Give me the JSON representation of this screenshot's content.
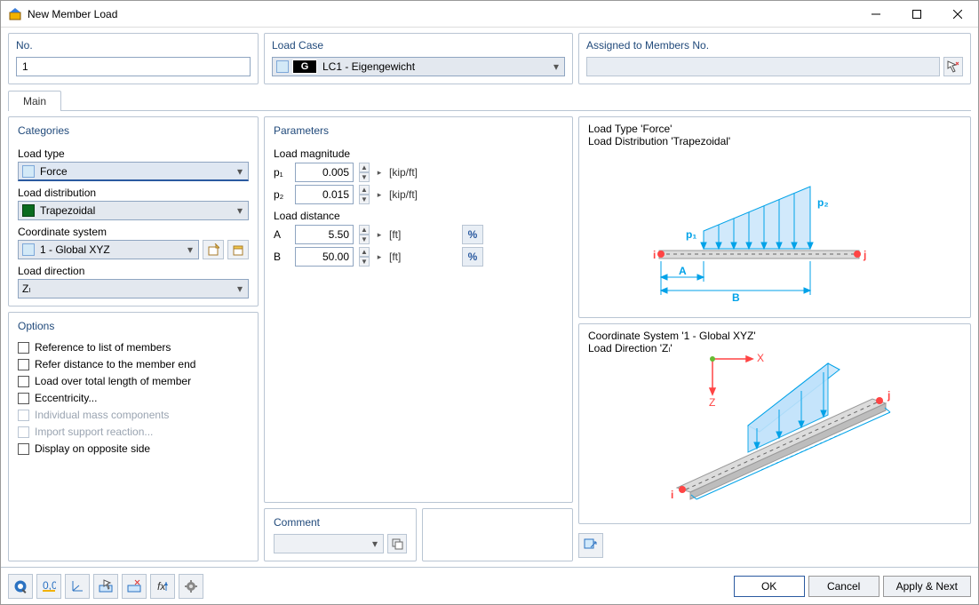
{
  "window": {
    "title": "New Member Load"
  },
  "header": {
    "no": {
      "legend": "No.",
      "value": "1"
    },
    "loadcase": {
      "legend": "Load Case",
      "badge": "G",
      "text": "LC1 - Eigengewicht"
    },
    "assigned": {
      "legend": "Assigned to Members No.",
      "value": ""
    }
  },
  "tabs": {
    "main": "Main"
  },
  "categories": {
    "title": "Categories",
    "load_type_label": "Load type",
    "load_type_value": "Force",
    "load_dist_label": "Load distribution",
    "load_dist_value": "Trapezoidal",
    "coord_sys_label": "Coordinate system",
    "coord_sys_value": "1 - Global XYZ",
    "load_dir_label": "Load direction",
    "load_dir_value": "Zₗ"
  },
  "options": {
    "title": "Options",
    "o1": "Reference to list of members",
    "o2": "Refer distance to the member end",
    "o3": "Load over total length of member",
    "o4": "Eccentricity...",
    "o5": "Individual mass components",
    "o6": "Import support reaction...",
    "o7": "Display on opposite side"
  },
  "parameters": {
    "title": "Parameters",
    "magnitude_label": "Load magnitude",
    "p1_label": "p₁",
    "p1_value": "0.005",
    "p1_unit": "[kip/ft]",
    "p2_label": "p₂",
    "p2_value": "0.015",
    "p2_unit": "[kip/ft]",
    "distance_label": "Load distance",
    "A_label": "A",
    "A_value": "5.50",
    "A_unit": "[ft]",
    "B_label": "B",
    "B_value": "50.00",
    "B_unit": "[ft]",
    "percent": "%"
  },
  "diagrams": {
    "d1_line1": "Load Type 'Force'",
    "d1_line2": "Load Distribution 'Trapezoidal'",
    "d1_p1": "p₁",
    "d1_p2": "p₂",
    "d1_i": "i",
    "d1_j": "j",
    "d1_A": "A",
    "d1_B": "B",
    "d2_line1": "Coordinate System '1 - Global XYZ'",
    "d2_line2": "Load Direction 'Zₗ'",
    "d2_x": "X",
    "d2_z": "Z",
    "d2_i": "i",
    "d2_j": "j"
  },
  "comment": {
    "title": "Comment",
    "value": ""
  },
  "footer": {
    "ok": "OK",
    "cancel": "Cancel",
    "apply_next": "Apply & Next"
  }
}
